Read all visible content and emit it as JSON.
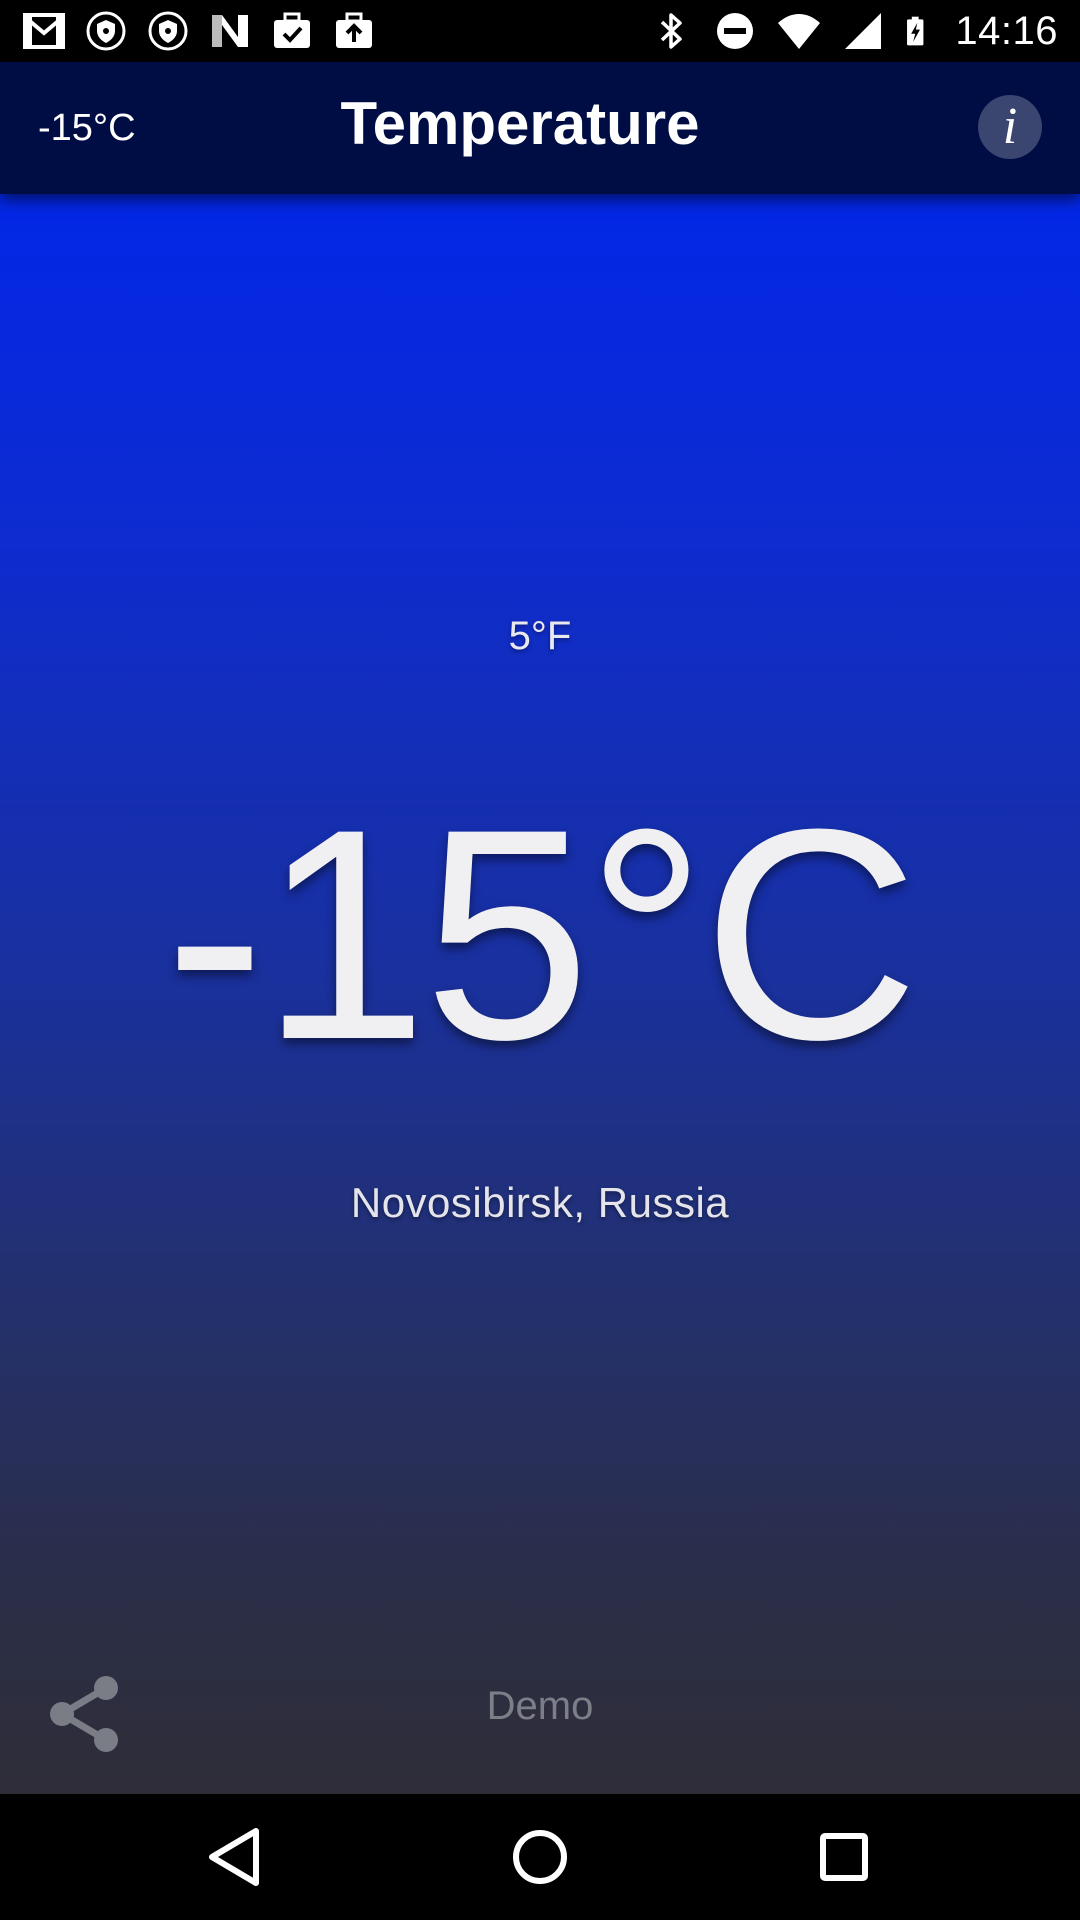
{
  "status_bar": {
    "time": "14:16",
    "left_icons": [
      "gmail-icon",
      "shield-icon",
      "shield-icon",
      "n-app-icon",
      "briefcase-check-icon",
      "briefcase-upload-icon"
    ],
    "right_icons": [
      "bluetooth-icon",
      "do-not-disturb-icon",
      "wifi-icon",
      "cell-signal-icon",
      "battery-charging-icon"
    ]
  },
  "app_bar": {
    "temperature": "-15°C",
    "title": "Temperature",
    "info_label": "i",
    "background": "#000c44"
  },
  "main": {
    "fahrenheit": "5°F",
    "celsius": "-15°C",
    "location": "Novosibirsk, Russia",
    "gradient_top": "#0227e7",
    "gradient_bottom": "#2e2d38"
  },
  "footer": {
    "share_icon": "share-icon",
    "demo_label": "Demo"
  },
  "nav_bar": {
    "icons": [
      "back-icon",
      "home-icon",
      "recents-icon"
    ]
  }
}
